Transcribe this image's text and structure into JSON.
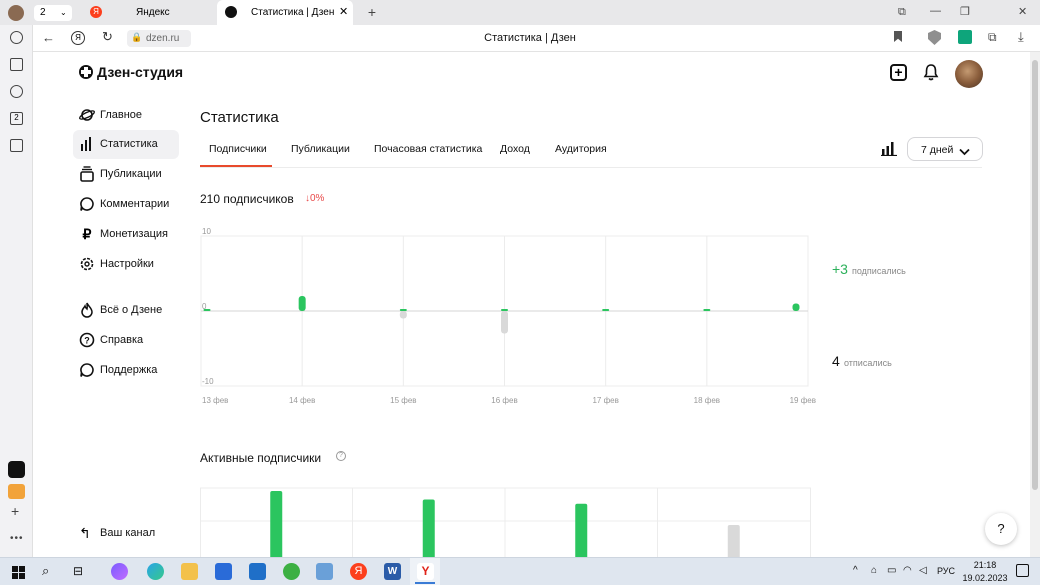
{
  "browser": {
    "tab_counter": "2",
    "tabs": [
      {
        "label": "Яндекс"
      },
      {
        "label": "Статистика | Дзен"
      }
    ],
    "url": "dzen.ru",
    "page_title": "Статистика | Дзен"
  },
  "left_rail": {
    "badge": "2"
  },
  "studio": {
    "logo_text": "Дзен-студия",
    "nav": [
      {
        "label": "Главное",
        "icon": "planet-icon"
      },
      {
        "label": "Статистика",
        "icon": "bar-chart-icon",
        "active": true
      },
      {
        "label": "Публикации",
        "icon": "stack-icon"
      },
      {
        "label": "Комментарии",
        "icon": "comment-icon"
      },
      {
        "label": "Монетизация",
        "icon": "ruble-icon"
      },
      {
        "label": "Настройки",
        "icon": "gear-icon"
      }
    ],
    "nav2": [
      {
        "label": "Всё о Дзене",
        "icon": "flame-icon"
      },
      {
        "label": "Справка",
        "icon": "question-icon"
      },
      {
        "label": "Поддержка",
        "icon": "chat-icon"
      }
    ],
    "your_channel": "Ваш канал"
  },
  "main": {
    "title": "Статистика",
    "tabs": [
      "Подписчики",
      "Публикации",
      "Почасовая статистика",
      "Доход",
      "Аудитория"
    ],
    "period": "7 дней",
    "subscribers_count": "210 подписчиков",
    "change": "0%",
    "subscribed_value": "+3",
    "subscribed_label": "подписались",
    "unsubscribed_value": "4",
    "unsubscribed_label": "отписались",
    "active_title": "Активные подписчики",
    "help_button": "?"
  },
  "chart_data": [
    {
      "type": "bar",
      "categories": [
        "13 фев",
        "14 фев",
        "15 фев",
        "16 фев",
        "17 фев",
        "18 фев",
        "19 фев"
      ],
      "series": [
        {
          "name": "подписались",
          "values": [
            0,
            2,
            0,
            0,
            0,
            0,
            1
          ]
        },
        {
          "name": "отписались",
          "values": [
            0,
            0,
            -1,
            -3,
            0,
            0,
            0
          ]
        }
      ],
      "ytick_labels": [
        "10",
        "0",
        "-10"
      ],
      "ylim": [
        -10,
        10
      ],
      "colors": {
        "positive": "#2bc55f",
        "negative": "#d9d9d9"
      }
    },
    {
      "type": "bar",
      "values": [
        10,
        9,
        8.5,
        6
      ],
      "colors": [
        "#2bc55f",
        "#2bc55f",
        "#2bc55f",
        "#d9d9d9"
      ]
    }
  ],
  "taskbar": {
    "time": "21:18",
    "date": "19.02.2023",
    "lang": "РУС"
  }
}
